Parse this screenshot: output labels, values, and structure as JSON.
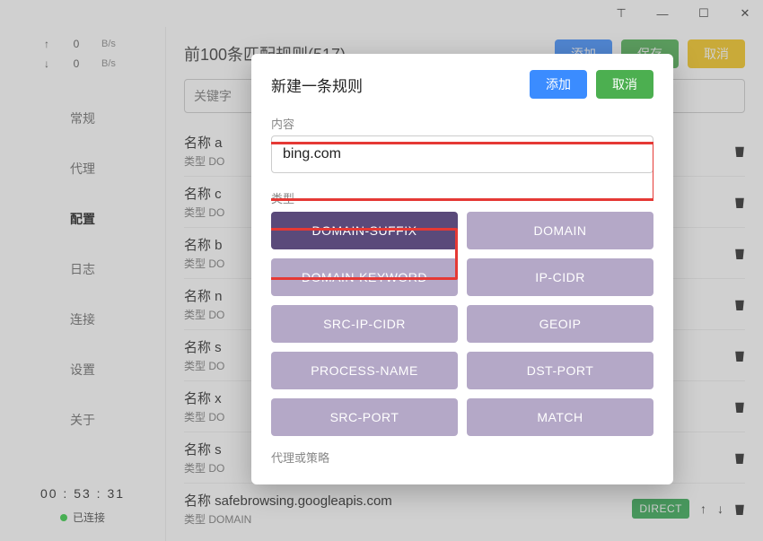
{
  "titlebar": {
    "pin": "⊤",
    "min": "—",
    "max": "☐",
    "close": "✕"
  },
  "speed": {
    "up_arrow": "↑",
    "up_val": "0",
    "up_unit": "B/s",
    "down_arrow": "↓",
    "down_val": "0",
    "down_unit": "B/s"
  },
  "nav": {
    "items": [
      "常规",
      "代理",
      "配置",
      "日志",
      "连接",
      "设置",
      "关于"
    ],
    "active_index": 2
  },
  "footer": {
    "timer": "00 : 53 : 31",
    "status": "已连接"
  },
  "main": {
    "title": "前100条匹配规则(517)",
    "add": "添加",
    "save": "保存",
    "cancel": "取消",
    "search_placeholder": "关键字",
    "name_prefix": "名称 ",
    "type_prefix": "类型 DO",
    "rules": [
      {
        "name": "a",
        "type": "DO"
      },
      {
        "name": "c",
        "type": "DO"
      },
      {
        "name": "b",
        "type": "DO"
      },
      {
        "name": "n",
        "type": "DO"
      },
      {
        "name": "s",
        "type": "DO"
      },
      {
        "name": "x",
        "type": "DO"
      },
      {
        "name": "s",
        "type": "DO"
      },
      {
        "name": "safebrowsing.googleapis.com",
        "type": "DOMAIN"
      }
    ],
    "direct": "DIRECT"
  },
  "modal": {
    "title": "新建一条规则",
    "add": "添加",
    "cancel": "取消",
    "content_label": "内容",
    "content_value": "bing.com",
    "type_label": "类型",
    "types": [
      "DOMAIN-SUFFIX",
      "DOMAIN",
      "DOMAIN-KEYWORD",
      "IP-CIDR",
      "SRC-IP-CIDR",
      "GEOIP",
      "PROCESS-NAME",
      "DST-PORT",
      "SRC-PORT",
      "MATCH"
    ],
    "selected_type_index": 0,
    "proxy_label": "代理或策略"
  }
}
